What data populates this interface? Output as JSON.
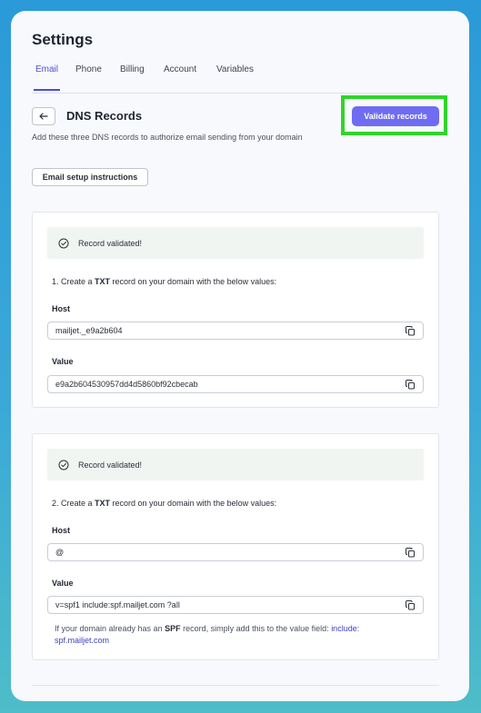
{
  "page": {
    "title": "Settings"
  },
  "tabs": [
    {
      "label": "Email",
      "active": true
    },
    {
      "label": "Phone",
      "active": false
    },
    {
      "label": "Billing",
      "active": false
    },
    {
      "label": "Account",
      "active": false
    },
    {
      "label": "Variables",
      "active": false
    }
  ],
  "header": {
    "section_title": "DNS Records",
    "subtitle": "Add these three DNS records to authorize email sending from your domain",
    "validate_label": "Validate records",
    "setup_label": "Email setup instructions"
  },
  "records": [
    {
      "status": "Record validated!",
      "step_prefix": "1. Create a ",
      "record_type": "TXT",
      "step_suffix": " record on your domain with the below values:",
      "host_label": "Host",
      "host_value": "mailjet._e9a2b604",
      "value_label": "Value",
      "value_value": "e9a2b604530957dd4d5860bf92cbecab"
    },
    {
      "status": "Record validated!",
      "step_prefix": "2. Create a ",
      "record_type": "TXT",
      "step_suffix": " record on your domain with the below values:",
      "host_label": "Host",
      "host_value": "@",
      "value_label": "Value",
      "value_value": "v=spf1 include:spf.mailjet.com ?all",
      "note_prefix": "If your domain already has an ",
      "note_bold": "SPF",
      "note_middle": " record, simply add this to the value field: ",
      "note_link": "include: spf.mailjet.com"
    }
  ],
  "colors": {
    "accent": "#6f6cf3",
    "active_tab": "#4b4fd4",
    "highlight": "#2fd52a",
    "validated_bg": "#f0f5f2"
  },
  "icons": [
    "arrow-left-icon",
    "check-circle-icon",
    "copy-icon"
  ]
}
